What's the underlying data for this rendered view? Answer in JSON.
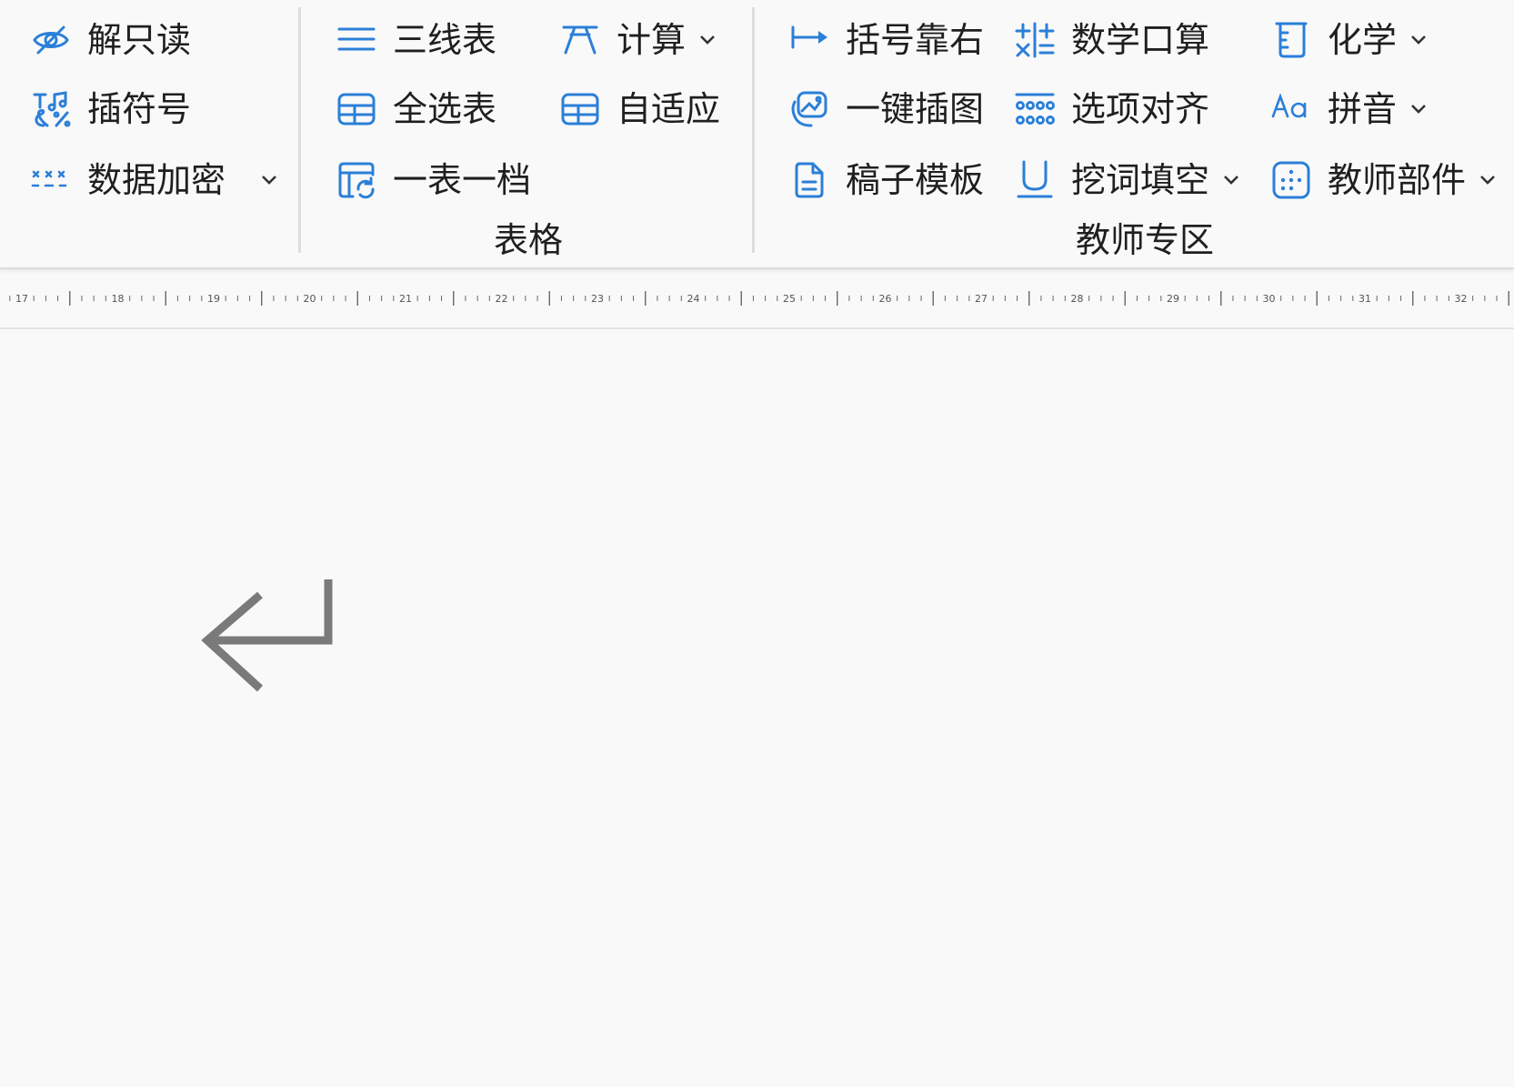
{
  "colors": {
    "icon_blue": "#2b7fd8",
    "text": "#1f1f1f",
    "ruler_text": "#555555",
    "paragraph_mark": "#7a7a7a"
  },
  "ribbon": {
    "group_misc": {
      "items": [
        {
          "label": "解只读",
          "icon": "eye-off-icon"
        },
        {
          "label": "插符号",
          "icon": "symbol-icon"
        },
        {
          "label": "数据加密",
          "icon": "encrypt-icon",
          "dropdown": true
        }
      ]
    },
    "group_table": {
      "label": "表格",
      "items": [
        {
          "label": "三线表",
          "icon": "three-line-table-icon"
        },
        {
          "label": "计算",
          "icon": "calculate-icon",
          "dropdown": true
        },
        {
          "label": "全选表",
          "icon": "select-table-icon"
        },
        {
          "label": "自适应",
          "icon": "autofit-table-icon"
        },
        {
          "label": "一表一档",
          "icon": "table-split-icon"
        }
      ]
    },
    "group_teacher": {
      "label": "教师专区",
      "items": [
        {
          "label": "括号靠右",
          "icon": "align-right-arrow-icon"
        },
        {
          "label": "数学口算",
          "icon": "math-oral-icon"
        },
        {
          "label": "化学",
          "icon": "beaker-icon",
          "dropdown": true
        },
        {
          "label": "一键插图",
          "icon": "insert-image-icon"
        },
        {
          "label": "选项对齐",
          "icon": "options-align-icon"
        },
        {
          "label": "拼音",
          "icon": "pinyin-icon",
          "dropdown": true
        },
        {
          "label": "稿子模板",
          "icon": "document-template-icon"
        },
        {
          "label": "挖词填空",
          "icon": "underline-fill-icon",
          "dropdown": true
        },
        {
          "label": "教师部件",
          "icon": "teacher-parts-icon",
          "dropdown": true
        }
      ]
    }
  },
  "ruler": {
    "labels": [
      "17",
      "18",
      "19",
      "20",
      "21",
      "22",
      "23",
      "24",
      "25",
      "26",
      "27",
      "28",
      "29",
      "30",
      "31",
      "32"
    ]
  },
  "document": {
    "paragraph_mark": "↵"
  }
}
